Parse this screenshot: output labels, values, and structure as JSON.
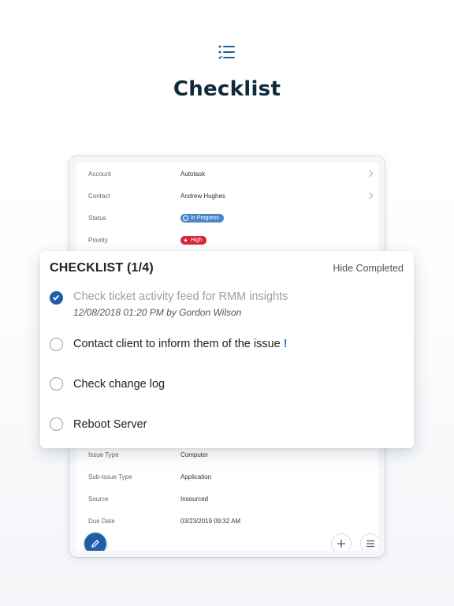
{
  "page": {
    "title": "Checklist",
    "icon": "checklist-icon"
  },
  "ticket_fields": {
    "top": [
      {
        "label": "Account",
        "value": "Autotask",
        "chevron": true
      },
      {
        "label": "Contact",
        "value": "Andrew Hughes",
        "chevron": true
      },
      {
        "label": "Status",
        "value": "In Progress",
        "badge": "blue"
      },
      {
        "label": "Priority",
        "value": "High",
        "badge": "red"
      }
    ],
    "bottom": [
      {
        "label": "Issue Type",
        "value": "Computer"
      },
      {
        "label": "Sub-Issue Type",
        "value": "Application"
      },
      {
        "label": "Source",
        "value": "Insourced"
      },
      {
        "label": "Due Date",
        "value": "03/23/2019 09:32 AM"
      }
    ]
  },
  "checklist": {
    "title": "CHECKLIST (1/4)",
    "hide_completed_label": "Hide Completed",
    "items": [
      {
        "text": "Check ticket activity feed for RMM insights",
        "completed": true,
        "meta": "12/08/2018 01:20 PM by Gordon Wilson"
      },
      {
        "text": "Contact client to inform them of the issue",
        "completed": false,
        "important": "!"
      },
      {
        "text": "Check change log",
        "completed": false
      },
      {
        "text": "Reboot Server",
        "completed": false
      }
    ]
  },
  "actions": {
    "edit_icon": "pencil-icon",
    "add_icon": "plus-icon",
    "menu_icon": "menu-icon"
  },
  "colors": {
    "accent": "#1f5ea8",
    "title": "#0f2a3d",
    "status_blue": "#4a86c8",
    "priority_red": "#d6273a",
    "important": "#1f6fd0"
  }
}
